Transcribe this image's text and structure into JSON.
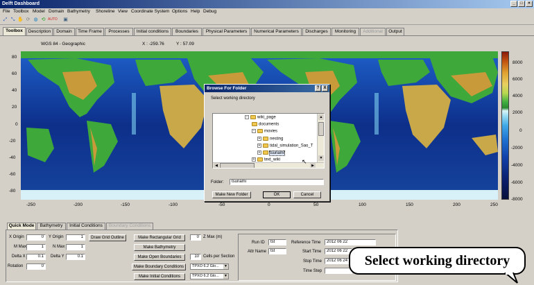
{
  "window": {
    "title": "Delft Dashboard"
  },
  "menu": [
    "File",
    "Toolbox",
    "Model",
    "Domain",
    "Bathymetry",
    "Shoreline",
    "View",
    "Coordinate System",
    "Options",
    "Help",
    "Debug"
  ],
  "tabs": [
    {
      "label": "Toolbox",
      "state": "active"
    },
    {
      "label": "Description",
      "state": "normal"
    },
    {
      "label": "Domain",
      "state": "normal"
    },
    {
      "label": "Time Frame",
      "state": "normal"
    },
    {
      "label": "Processes",
      "state": "normal"
    },
    {
      "label": "Initial conditions",
      "state": "normal"
    },
    {
      "label": "Boundaries",
      "state": "normal"
    },
    {
      "label": "Physical Parameters",
      "state": "normal"
    },
    {
      "label": "Numerical Parameters",
      "state": "normal"
    },
    {
      "label": "Discharges",
      "state": "normal"
    },
    {
      "label": "Monitoring",
      "state": "normal"
    },
    {
      "label": "Additional",
      "state": "disabled"
    },
    {
      "label": "Output",
      "state": "normal"
    }
  ],
  "coords": {
    "system": "WGS 84 - Geographic",
    "x": "X : -259.76",
    "y": "Y : 57.09"
  },
  "map": {
    "yticks": [
      "80",
      "60",
      "40",
      "20",
      "0",
      "-20",
      "-40",
      "-60",
      "-80"
    ],
    "xticks": [
      "-250",
      "-200",
      "-150",
      "-100",
      "-50",
      "0",
      "50",
      "100",
      "150",
      "200",
      "250"
    ],
    "colorbar_ticks": [
      "8000",
      "6000",
      "4000",
      "2000",
      "0",
      "-2000",
      "-4000",
      "-6000",
      "-8000"
    ],
    "colors": {
      "ocean_deep": "#0d2f8a",
      "ocean_mid": "#1e5fc8",
      "shelf": "#7fd0f0",
      "land_low": "#3ea83a",
      "land_high": "#c89a3a"
    }
  },
  "dialog": {
    "title": "Browse For Folder",
    "help_btn": "?",
    "close_btn": "X",
    "prompt": "Select working directory",
    "tree": [
      {
        "label": "wiki_page",
        "expander": "−"
      },
      {
        "label": "documents",
        "expander": ""
      },
      {
        "label": "movies",
        "expander": "−"
      },
      {
        "label": "nesting",
        "expander": "+"
      },
      {
        "label": "tidal_simulation_Sao_T",
        "expander": "+"
      },
      {
        "label": "tsunami",
        "expander": "+"
      },
      {
        "label": "text_wiki",
        "expander": "+"
      }
    ],
    "folder_label": "Folder:",
    "folder_value": "tsunami",
    "new_folder": "Make New Folder",
    "ok": "OK",
    "cancel": "Cancel"
  },
  "bottom_tabs": [
    {
      "label": "Quick Mode",
      "state": "active"
    },
    {
      "label": "Bathymetry",
      "state": "normal"
    },
    {
      "label": "Initial Conditions",
      "state": "normal"
    },
    {
      "label": "Boundary Conditions",
      "state": "disabled"
    }
  ],
  "quick": {
    "x_origin_label": "X Origin",
    "x_origin": "0",
    "y_origin_label": "Y Origin",
    "y_origin": "1",
    "m_max_label": "M Max",
    "m_max": "1",
    "n_max_label": "N Max",
    "n_max": "1",
    "delta_x_label": "Delta X",
    "delta_x": "0.1",
    "delta_y_label": "Delta Y",
    "delta_y": "0.1",
    "rotation_label": "Rotation",
    "rotation": "0",
    "draw_grid": "Draw Grid Outline",
    "make_rect_grid": "Make Rectangular Grid",
    "make_bathy": "Make Bathymetry",
    "make_open_bnd": "Make Open Boundaries",
    "make_bnd_cond": "Make Boundary Conditions",
    "make_init_cond": "Make Initial Conditions",
    "zmax_value": "0",
    "zmax_label": "Z Max (m)",
    "cells_value": "10",
    "cells_label": "Cells per Section",
    "tpxo_1": "TPXO 6.2 Glo...",
    "tpxo_2": "TPXO 6.2 Glo..."
  },
  "run": {
    "run_id_label": "Run ID",
    "run_id": "tst",
    "attr_name_label": "Attr Name",
    "attr_name": "tst",
    "ref_time_label": "Reference Time",
    "ref_time": "2012 06 22",
    "start_time_label": "Start Time",
    "start_time": "2012 06 22",
    "stop_time_label": "Stop Time",
    "stop_time": "2012 06 24",
    "time_step_label": "Time Step"
  },
  "callout": "Select working directory"
}
